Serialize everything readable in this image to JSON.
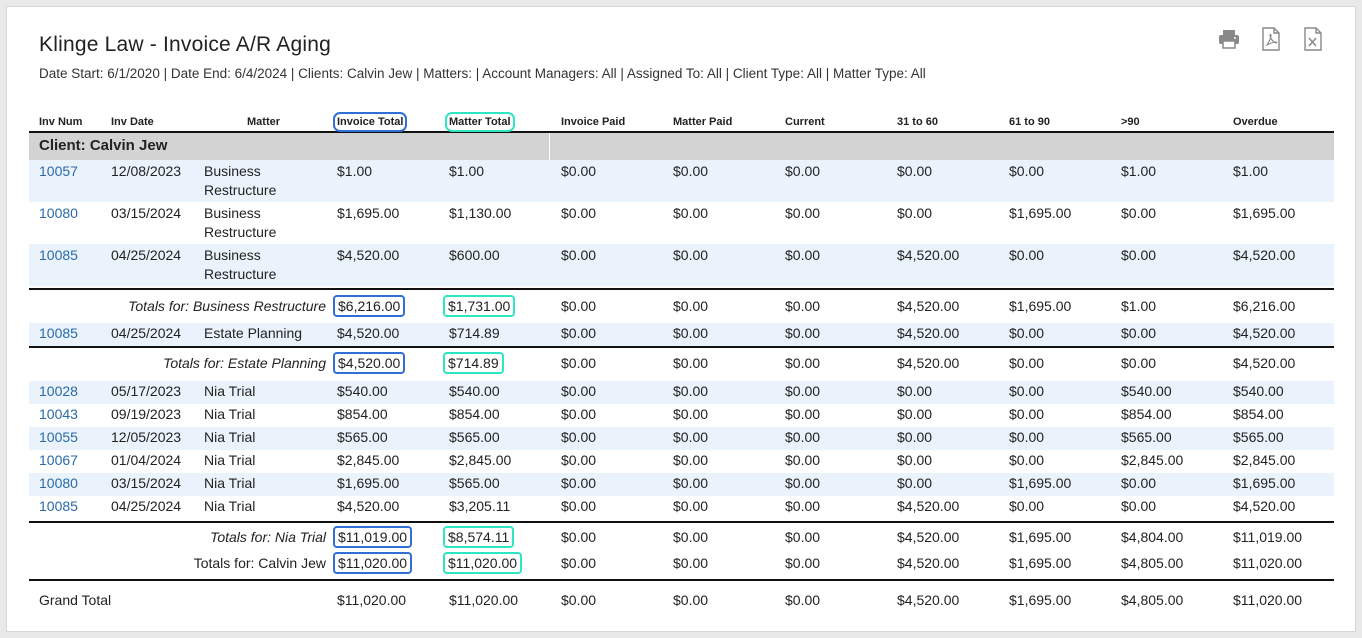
{
  "report": {
    "title": "Klinge Law - Invoice A/R Aging",
    "filters": "Date Start: 6/1/2020 | Date End: 6/4/2024 | Clients: Calvin Jew | Matters: | Account Managers: All | Assigned To: All | Client Type: All | Matter Type: All"
  },
  "toolbar": {
    "icons": [
      "print-icon",
      "pdf-icon",
      "excel-icon"
    ]
  },
  "columns": [
    "Inv Num",
    "Inv Date",
    "Matter",
    "Invoice Total",
    "Matter Total",
    "Invoice Paid",
    "Matter Paid",
    "Current",
    "31 to 60",
    "61 to 90",
    ">90",
    "Overdue"
  ],
  "client": {
    "label": "Client: Calvin Jew"
  },
  "rows": [
    {
      "inv": "10057",
      "date": "12/08/2023",
      "matter": "Business Restructure",
      "inv_total": "$1.00",
      "matter_total": "$1.00",
      "inv_paid": "$0.00",
      "matter_paid": "$0.00",
      "current": "$0.00",
      "d31": "$0.00",
      "d61": "$0.00",
      "d90": "$1.00",
      "overdue": "$1.00"
    },
    {
      "inv": "10080",
      "date": "03/15/2024",
      "matter": "Business Restructure",
      "inv_total": "$1,695.00",
      "matter_total": "$1,130.00",
      "inv_paid": "$0.00",
      "matter_paid": "$0.00",
      "current": "$0.00",
      "d31": "$0.00",
      "d61": "$1,695.00",
      "d90": "$0.00",
      "overdue": "$1,695.00"
    },
    {
      "inv": "10085",
      "date": "04/25/2024",
      "matter": "Business Restructure",
      "inv_total": "$4,520.00",
      "matter_total": "$600.00",
      "inv_paid": "$0.00",
      "matter_paid": "$0.00",
      "current": "$0.00",
      "d31": "$4,520.00",
      "d61": "$0.00",
      "d90": "$0.00",
      "overdue": "$4,520.00"
    },
    {
      "inv": "10085",
      "date": "04/25/2024",
      "matter": "Estate Planning",
      "inv_total": "$4,520.00",
      "matter_total": "$714.89",
      "inv_paid": "$0.00",
      "matter_paid": "$0.00",
      "current": "$0.00",
      "d31": "$4,520.00",
      "d61": "$0.00",
      "d90": "$0.00",
      "overdue": "$4,520.00"
    },
    {
      "inv": "10028",
      "date": "05/17/2023",
      "matter": "Nia Trial",
      "inv_total": "$540.00",
      "matter_total": "$540.00",
      "inv_paid": "$0.00",
      "matter_paid": "$0.00",
      "current": "$0.00",
      "d31": "$0.00",
      "d61": "$0.00",
      "d90": "$540.00",
      "overdue": "$540.00"
    },
    {
      "inv": "10043",
      "date": "09/19/2023",
      "matter": "Nia Trial",
      "inv_total": "$854.00",
      "matter_total": "$854.00",
      "inv_paid": "$0.00",
      "matter_paid": "$0.00",
      "current": "$0.00",
      "d31": "$0.00",
      "d61": "$0.00",
      "d90": "$854.00",
      "overdue": "$854.00"
    },
    {
      "inv": "10055",
      "date": "12/05/2023",
      "matter": "Nia Trial",
      "inv_total": "$565.00",
      "matter_total": "$565.00",
      "inv_paid": "$0.00",
      "matter_paid": "$0.00",
      "current": "$0.00",
      "d31": "$0.00",
      "d61": "$0.00",
      "d90": "$565.00",
      "overdue": "$565.00"
    },
    {
      "inv": "10067",
      "date": "01/04/2024",
      "matter": "Nia Trial",
      "inv_total": "$2,845.00",
      "matter_total": "$2,845.00",
      "inv_paid": "$0.00",
      "matter_paid": "$0.00",
      "current": "$0.00",
      "d31": "$0.00",
      "d61": "$0.00",
      "d90": "$2,845.00",
      "overdue": "$2,845.00"
    },
    {
      "inv": "10080",
      "date": "03/15/2024",
      "matter": "Nia Trial",
      "inv_total": "$1,695.00",
      "matter_total": "$565.00",
      "inv_paid": "$0.00",
      "matter_paid": "$0.00",
      "current": "$0.00",
      "d31": "$0.00",
      "d61": "$1,695.00",
      "d90": "$0.00",
      "overdue": "$1,695.00"
    },
    {
      "inv": "10085",
      "date": "04/25/2024",
      "matter": "Nia Trial",
      "inv_total": "$4,520.00",
      "matter_total": "$3,205.11",
      "inv_paid": "$0.00",
      "matter_paid": "$0.00",
      "current": "$0.00",
      "d31": "$4,520.00",
      "d61": "$0.00",
      "d90": "$0.00",
      "overdue": "$4,520.00"
    }
  ],
  "totals": [
    {
      "label": "Totals for: Business Restructure",
      "inv_total": "$6,216.00",
      "matter_total": "$1,731.00",
      "inv_paid": "$0.00",
      "matter_paid": "$0.00",
      "current": "$0.00",
      "d31": "$4,520.00",
      "d61": "$1,695.00",
      "d90": "$1.00",
      "overdue": "$6,216.00"
    },
    {
      "label": "Totals for: Estate Planning",
      "inv_total": "$4,520.00",
      "matter_total": "$714.89",
      "inv_paid": "$0.00",
      "matter_paid": "$0.00",
      "current": "$0.00",
      "d31": "$4,520.00",
      "d61": "$0.00",
      "d90": "$0.00",
      "overdue": "$4,520.00"
    },
    {
      "label": "Totals for: Nia Trial",
      "inv_total": "$11,019.00",
      "matter_total": "$8,574.11",
      "inv_paid": "$0.00",
      "matter_paid": "$0.00",
      "current": "$0.00",
      "d31": "$4,520.00",
      "d61": "$1,695.00",
      "d90": "$4,804.00",
      "overdue": "$11,019.00"
    },
    {
      "label": "Totals for: Calvin Jew",
      "inv_total": "$11,020.00",
      "matter_total": "$11,020.00",
      "inv_paid": "$0.00",
      "matter_paid": "$0.00",
      "current": "$0.00",
      "d31": "$4,520.00",
      "d61": "$1,695.00",
      "d90": "$4,805.00",
      "overdue": "$11,020.00"
    }
  ],
  "grand": {
    "label": "Grand Total",
    "inv_total": "$11,020.00",
    "matter_total": "$11,020.00",
    "inv_paid": "$0.00",
    "matter_paid": "$0.00",
    "current": "$0.00",
    "d31": "$4,520.00",
    "d61": "$1,695.00",
    "d90": "$4,805.00",
    "overdue": "$11,020.00"
  },
  "colors": {
    "link": "#2a6aa8",
    "row_alt": "#eaf3fc",
    "client_bar": "#d3d3d3",
    "highlight_blue": "#2f6fd6",
    "highlight_teal": "#2ee6c3"
  }
}
